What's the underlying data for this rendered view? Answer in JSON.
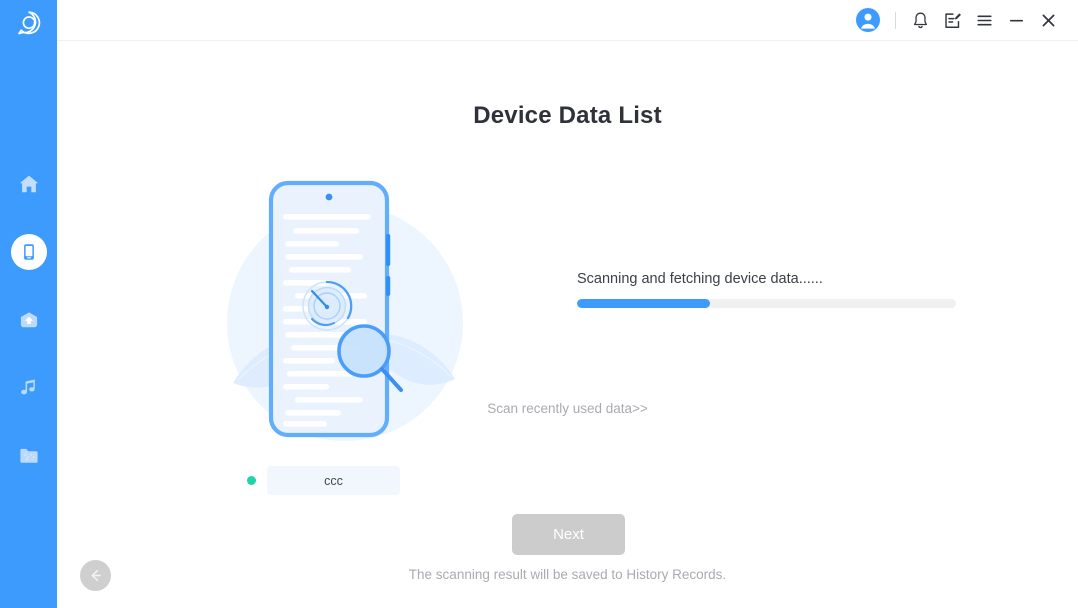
{
  "app": {
    "logo_icon": "chat-c-logo-icon",
    "accent_color": "#3d9bfe",
    "sidebar_color": "#3d9bfe"
  },
  "sidebar": {
    "items": [
      {
        "name": "home",
        "icon": "home-icon",
        "active": false
      },
      {
        "name": "device",
        "icon": "phone-icon",
        "active": true
      },
      {
        "name": "backup",
        "icon": "cloud-icon",
        "active": false
      },
      {
        "name": "music",
        "icon": "music-note-icon",
        "active": false
      },
      {
        "name": "files",
        "icon": "folder-icon",
        "active": false
      }
    ],
    "back_button": {
      "icon": "arrow-left-icon",
      "label": "Back"
    }
  },
  "header": {
    "tools": [
      {
        "name": "account",
        "icon": "user-avatar-icon"
      },
      {
        "name": "notifications",
        "icon": "bell-icon"
      },
      {
        "name": "feedback",
        "icon": "edit-note-icon"
      },
      {
        "name": "menu",
        "icon": "hamburger-menu-icon"
      },
      {
        "name": "minimize",
        "icon": "minimize-icon"
      },
      {
        "name": "close",
        "icon": "close-icon"
      }
    ]
  },
  "main": {
    "title": "Device Data List",
    "status_text": "Scanning and fetching device data......",
    "progress_percent": 35,
    "recent_link": "Scan recently used data>>",
    "device": {
      "name": "ccc",
      "status_color": "#22d3a5"
    },
    "next_label": "Next",
    "next_disabled": true,
    "footer_note": "The scanning result will be saved to History Records."
  }
}
